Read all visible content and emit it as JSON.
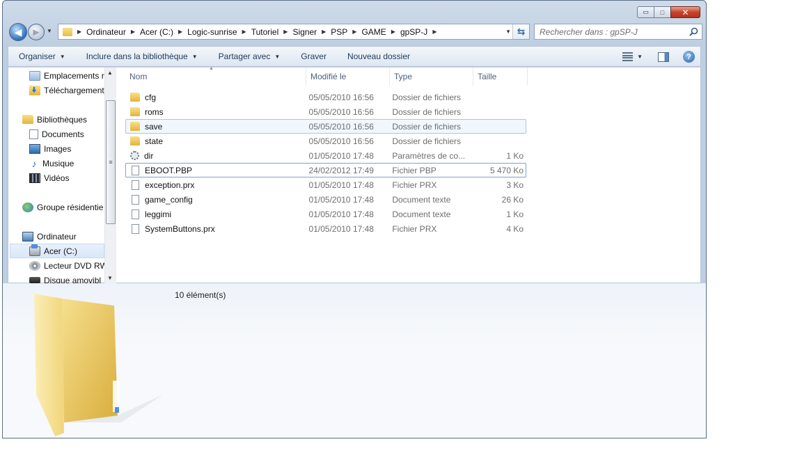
{
  "window": {
    "caption_buttons": {
      "minimize": "▭",
      "maximize": "□",
      "close": "✕"
    }
  },
  "nav": {
    "breadcrumb": [
      "Ordinateur",
      "Acer (C:)",
      "Logic-sunrise",
      "Tutoriel",
      "Signer",
      "PSP",
      "GAME",
      "gpSP-J"
    ],
    "search_placeholder": "Rechercher dans : gpSP-J"
  },
  "commands": {
    "organise": "Organiser",
    "include_library": "Inclure dans la bibliothèque",
    "share": "Partager avec",
    "burn": "Graver",
    "new_folder": "Nouveau dossier",
    "help": "?"
  },
  "navpane": {
    "items": [
      {
        "label": "Emplacements r",
        "icon": "places-icon"
      },
      {
        "label": "Téléchargement",
        "icon": "downloads-icon"
      },
      {
        "label": "Bibliothèques",
        "icon": "libraries-icon"
      },
      {
        "label": "Documents",
        "icon": "documents-icon"
      },
      {
        "label": "Images",
        "icon": "images-icon"
      },
      {
        "label": "Musique",
        "icon": "music-icon"
      },
      {
        "label": "Vidéos",
        "icon": "videos-icon"
      },
      {
        "label": "Groupe résidentie",
        "icon": "homegroup-icon"
      },
      {
        "label": "Ordinateur",
        "icon": "computer-icon"
      },
      {
        "label": "Acer (C:)",
        "icon": "drive-icon"
      },
      {
        "label": "Lecteur DVD RW",
        "icon": "dvd-icon"
      },
      {
        "label": "Disque amovibl",
        "icon": "usb-icon"
      }
    ]
  },
  "columns": {
    "name": "Nom",
    "modified": "Modifié le",
    "type": "Type",
    "size": "Taille"
  },
  "files": [
    {
      "name": "cfg",
      "date": "05/05/2010 16:56",
      "type": "Dossier de fichiers",
      "size": "",
      "icon": "folder-icon"
    },
    {
      "name": "roms",
      "date": "05/05/2010 16:56",
      "type": "Dossier de fichiers",
      "size": "",
      "icon": "folder-icon"
    },
    {
      "name": "save",
      "date": "05/05/2010 16:56",
      "type": "Dossier de fichiers",
      "size": "",
      "icon": "folder-icon"
    },
    {
      "name": "state",
      "date": "05/05/2010 16:56",
      "type": "Dossier de fichiers",
      "size": "",
      "icon": "folder-icon"
    },
    {
      "name": "dir",
      "date": "01/05/2010 17:48",
      "type": "Paramètres de co...",
      "size": "1 Ko",
      "icon": "config-file-icon"
    },
    {
      "name": "EBOOT.PBP",
      "date": "24/02/2012 17:49",
      "type": "Fichier PBP",
      "size": "5 470 Ko",
      "icon": "file-icon"
    },
    {
      "name": "exception.prx",
      "date": "01/05/2010 17:48",
      "type": "Fichier PRX",
      "size": "3 Ko",
      "icon": "file-icon"
    },
    {
      "name": "game_config",
      "date": "01/05/2010 17:48",
      "type": "Document texte",
      "size": "26 Ko",
      "icon": "text-file-icon"
    },
    {
      "name": "leggimi",
      "date": "01/05/2010 17:48",
      "type": "Document texte",
      "size": "1 Ko",
      "icon": "text-file-icon"
    },
    {
      "name": "SystemButtons.prx",
      "date": "01/05/2010 17:48",
      "type": "Fichier PRX",
      "size": "4 Ko",
      "icon": "file-icon"
    }
  ],
  "details": {
    "item_count": "10 élément(s)"
  },
  "colors": {
    "accent": "#1e395b",
    "selection": "#a9c5e6",
    "folder": "#e8bd45"
  }
}
